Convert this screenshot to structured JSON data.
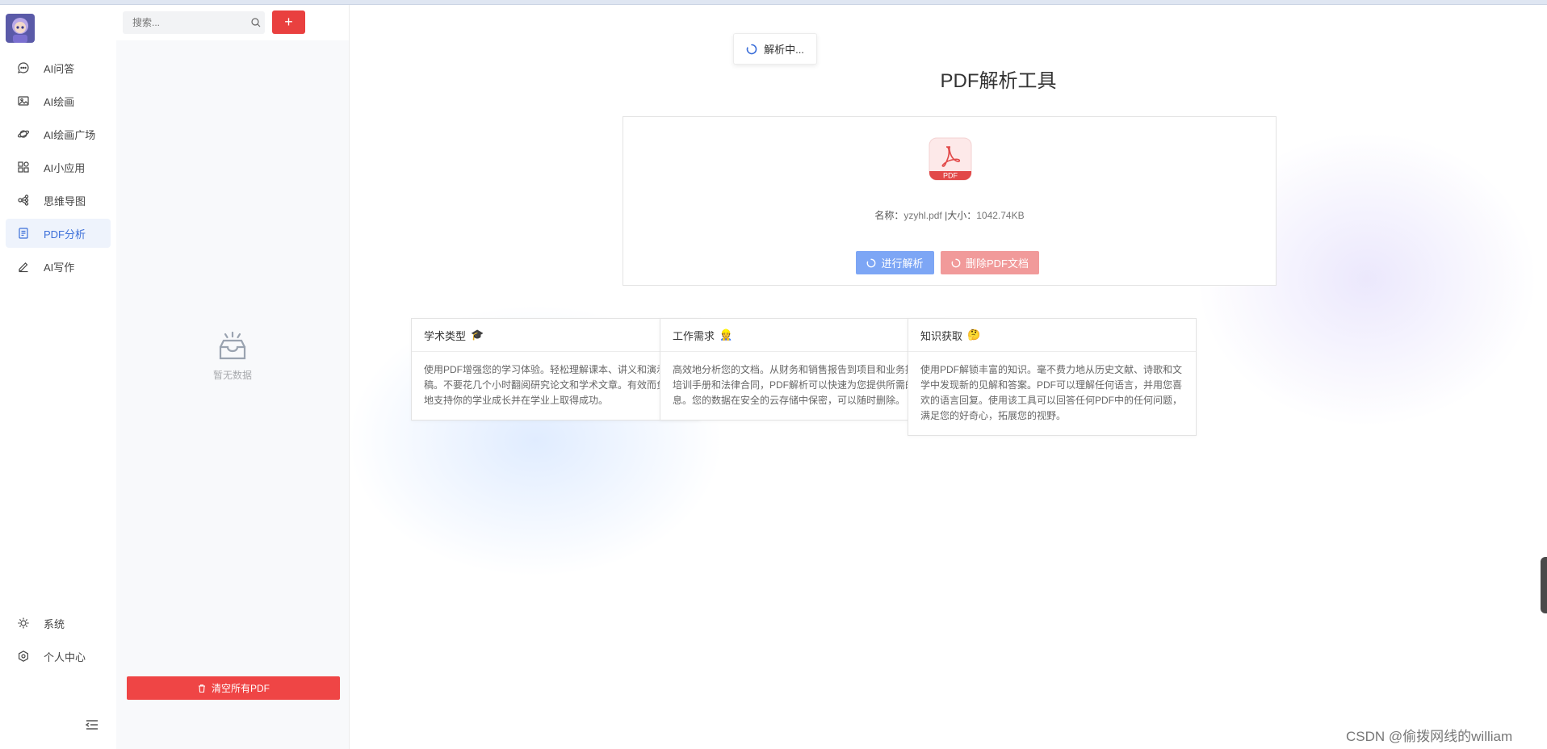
{
  "nav": {
    "items": [
      {
        "label": "AI问答",
        "icon": "chat-bubble-icon"
      },
      {
        "label": "AI绘画",
        "icon": "image-icon"
      },
      {
        "label": "AI绘画广场",
        "icon": "planet-icon"
      },
      {
        "label": "AI小应用",
        "icon": "apps-grid-icon"
      },
      {
        "label": "思维导图",
        "icon": "mindmap-icon"
      },
      {
        "label": "PDF分析",
        "icon": "document-icon",
        "active": true
      },
      {
        "label": "AI写作",
        "icon": "pen-icon"
      }
    ],
    "bottom": [
      {
        "label": "系统",
        "icon": "sun-settings-icon"
      },
      {
        "label": "个人中心",
        "icon": "user-center-icon"
      }
    ]
  },
  "sidebar": {
    "search_placeholder": "搜索...",
    "add_label": "+",
    "empty_text": "暂无数据",
    "clear_label": "清空所有PDF"
  },
  "main": {
    "toast": "解析中...",
    "title": "PDF解析工具",
    "file": {
      "icon_label": "PDF",
      "name_label": "名称：",
      "name": "yzyhl.pdf",
      "sep": " |",
      "size_label": "大小：",
      "size": "1042.74KB"
    },
    "parse_button": "进行解析",
    "delete_button": "删除PDF文档",
    "features": [
      {
        "title": "学术类型",
        "emoji": "🎓",
        "text": "使用PDF增强您的学习体验。轻松理解课本、讲义和演示文稿。不要花几个小时翻阅研究论文和学术文章。有效而负责任地支持你的学业成长并在学业上取得成功。"
      },
      {
        "title": "工作需求",
        "emoji": "👷",
        "text": "高效地分析您的文档。从财务和销售报告到项目和业务提案、培训手册和法律合同，PDF解析可以快速为您提供所需的信息。您的数据在安全的云存储中保密，可以随时删除。"
      },
      {
        "title": "知识获取",
        "emoji": "🤔",
        "text": "使用PDF解锁丰富的知识。毫不费力地从历史文献、诗歌和文学中发现新的见解和答案。PDF可以理解任何语言，并用您喜欢的语言回复。使用该工具可以回答任何PDF中的任何问题，满足您的好奇心，拓展您的视野。"
      }
    ]
  },
  "watermark": "CSDN @偷拨网线的william",
  "colors": {
    "accent": "#3c6fd9",
    "danger": "#ef4545",
    "parse_btn": "#7da6f5",
    "delete_btn": "#f19a9a"
  }
}
